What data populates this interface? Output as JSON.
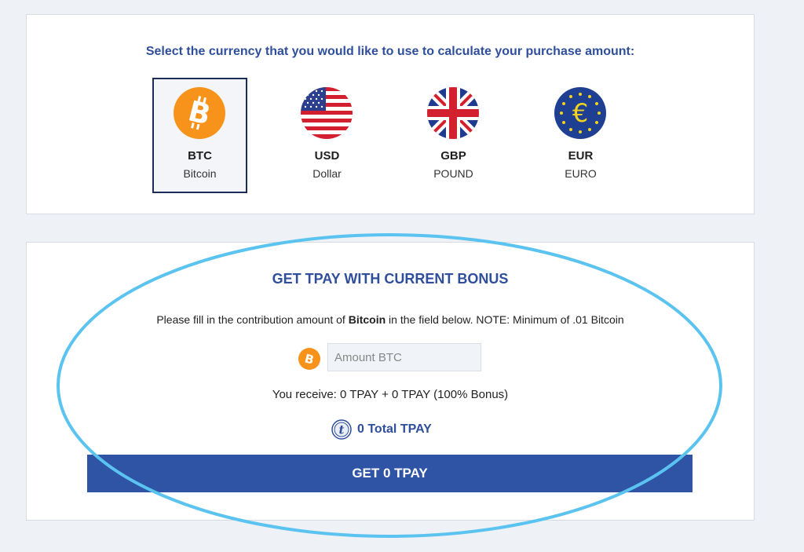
{
  "currency_select": {
    "title": "Select the currency that you would like to use to calculate your purchase amount:",
    "options": [
      {
        "code": "BTC",
        "name": "Bitcoin",
        "selected": true,
        "icon": "bitcoin-icon"
      },
      {
        "code": "USD",
        "name": "Dollar",
        "selected": false,
        "icon": "us-flag-icon"
      },
      {
        "code": "GBP",
        "name": "POUND",
        "selected": false,
        "icon": "uk-flag-icon"
      },
      {
        "code": "EUR",
        "name": "EURO",
        "selected": false,
        "icon": "euro-icon"
      }
    ]
  },
  "purchase": {
    "title": "GET TPAY WITH CURRENT BONUS",
    "note_prefix": "Please fill in the contribution amount of ",
    "note_currency": "Bitcoin",
    "note_suffix": " in the field below. NOTE: Minimum of .01 Bitcoin",
    "amount_placeholder": "Amount BTC",
    "amount_value": "",
    "receive_text": "You receive: 0 TPAY + 0 TPAY (100% Bonus)",
    "total_text": "0 Total TPAY",
    "button_label": "GET 0 TPAY"
  },
  "colors": {
    "accent": "#2f4f9c",
    "button": "#2f54a6",
    "bitcoin": "#f7931a",
    "highlight": "#5bc3f0",
    "background": "#eef1f6"
  }
}
